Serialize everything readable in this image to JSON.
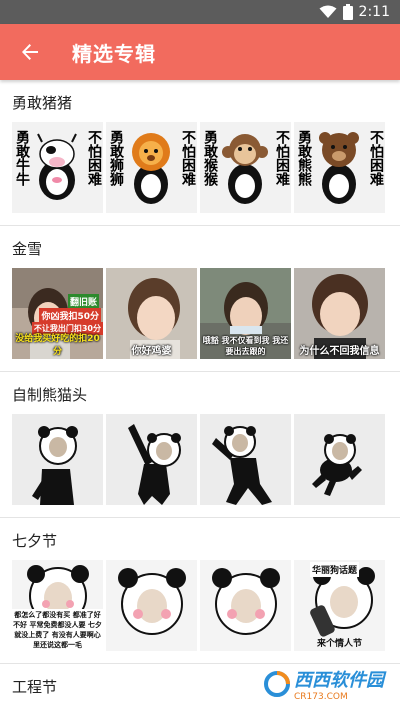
{
  "status_bar": {
    "time": "2:11"
  },
  "app_bar": {
    "title": "精选专辑",
    "accent": "#f26b5e"
  },
  "sections": [
    {
      "title": "勇敢猪猪",
      "items": [
        {
          "icon": "cow-sticker",
          "left": "勇敢牛牛",
          "right": "不怕困难"
        },
        {
          "icon": "lion-sticker",
          "left": "勇敢狮狮",
          "right": "不怕困难"
        },
        {
          "icon": "monkey-sticker",
          "left": "勇敢猴猴",
          "right": "不怕困难"
        },
        {
          "icon": "bear-sticker",
          "left": "勇敢熊熊",
          "right": "不怕困难"
        }
      ]
    },
    {
      "title": "金雪",
      "items": [
        {
          "icon": "child-photo-sticker",
          "caption": "没给我买好吃的扣20分",
          "tags": [
            "翻旧账",
            "你凶我扣50分",
            "不让我出门扣30分"
          ]
        },
        {
          "icon": "child-photo-sticker",
          "caption": "你好鸡婆"
        },
        {
          "icon": "child-photo-sticker",
          "caption": "哦豁 我不仅看到我 我还要出去跟的"
        },
        {
          "icon": "child-photo-sticker",
          "caption": "为什么不回我信息"
        }
      ]
    },
    {
      "title": "自制熊猫头",
      "items": [
        {
          "icon": "panda-meme"
        },
        {
          "icon": "panda-meme"
        },
        {
          "icon": "panda-meme"
        },
        {
          "icon": "panda-meme"
        }
      ]
    },
    {
      "title": "七夕节",
      "items": [
        {
          "icon": "panda-meme",
          "caption": "都怎么了都没有买 都准了好不好 平常免费都没人要 七夕就没上费了 有没有人要啊心里还说这都一毛"
        },
        {
          "icon": "panda-meme"
        },
        {
          "icon": "panda-meme"
        },
        {
          "icon": "panda-meme",
          "caption": "来个情人节",
          "tags": [
            "华丽狗话题"
          ]
        }
      ]
    }
  ],
  "next_section_partial": "工程节",
  "watermark": {
    "text": "西西软件园",
    "sub": "CR173.COM"
  }
}
